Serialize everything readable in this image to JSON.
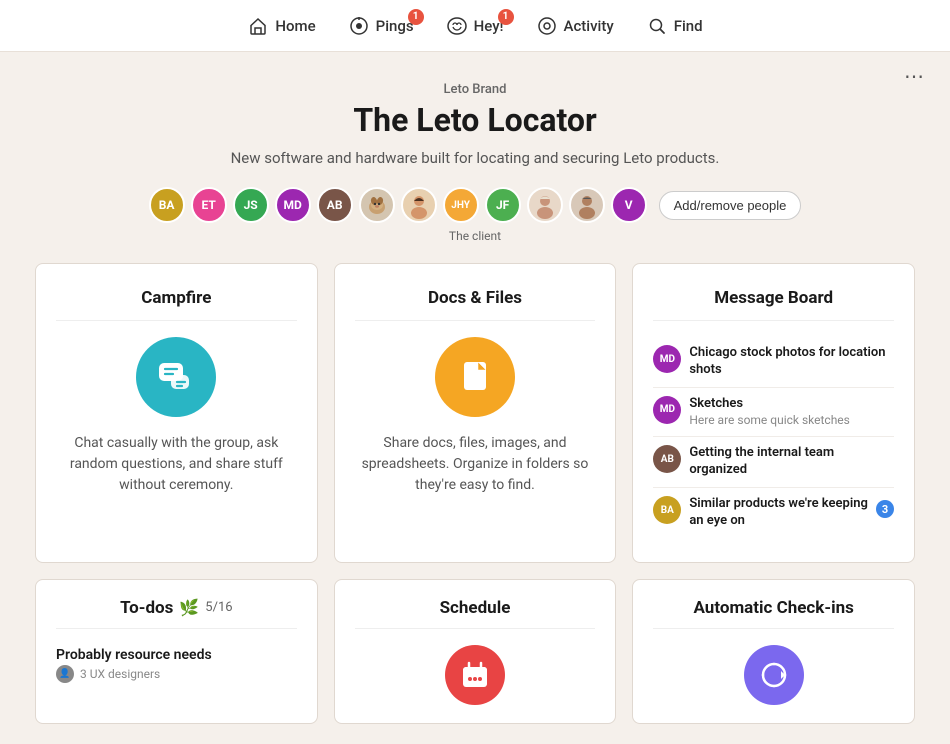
{
  "nav": {
    "items": [
      {
        "id": "home",
        "label": "Home",
        "icon": "🏠",
        "badge": null
      },
      {
        "id": "pings",
        "label": "Pings",
        "icon": "🔔",
        "badge": "1"
      },
      {
        "id": "hey",
        "label": "Hey!",
        "icon": "👋",
        "badge": "1"
      },
      {
        "id": "activity",
        "label": "Activity",
        "icon": "●",
        "badge": null
      },
      {
        "id": "find",
        "label": "Find",
        "icon": "🔍",
        "badge": null
      }
    ]
  },
  "project": {
    "brand": "Leto Brand",
    "title": "The Leto Locator",
    "description": "New software and hardware built for locating and securing Leto products."
  },
  "people": {
    "avatars": [
      {
        "initials": "BA",
        "color": "#c8a020",
        "type": "initials"
      },
      {
        "initials": "ET",
        "color": "#e84393",
        "type": "initials"
      },
      {
        "initials": "JS",
        "color": "#35a853",
        "type": "initials"
      },
      {
        "initials": "MD",
        "color": "#9c27b0",
        "type": "initials"
      },
      {
        "initials": "AB",
        "color": "#795548",
        "type": "initials"
      },
      {
        "initials": "🐶",
        "color": "#ddd",
        "type": "photo"
      },
      {
        "initials": "👩",
        "color": "#ddd",
        "type": "photo"
      },
      {
        "initials": "JHY",
        "color": "#f4a836",
        "type": "initials"
      },
      {
        "initials": "JF",
        "color": "#4caf50",
        "type": "initials"
      },
      {
        "initials": "👩‍🦳",
        "color": "#ddd",
        "type": "photo"
      },
      {
        "initials": "👨",
        "color": "#ddd",
        "type": "photo"
      },
      {
        "initials": "V",
        "color": "#9c27b0",
        "type": "initials"
      }
    ],
    "add_label": "Add/remove people",
    "group_label": "The client"
  },
  "cards": {
    "campfire": {
      "title": "Campfire",
      "desc": "Chat casually with the group, ask random questions, and share stuff without ceremony.",
      "icon_color": "#29b5c4",
      "icon": "💬"
    },
    "docs": {
      "title": "Docs & Files",
      "desc": "Share docs, files, images, and spreadsheets. Organize in folders so they're easy to find.",
      "icon_color": "#f5a623",
      "icon": "📄"
    },
    "message_board": {
      "title": "Message Board",
      "items": [
        {
          "initials": "MD",
          "color": "#9c27b0",
          "title": "Chicago stock photos for location shots",
          "sub": null,
          "badge": null
        },
        {
          "initials": "MD",
          "color": "#9c27b0",
          "title": "Sketches",
          "sub": "Here are some quick sketches",
          "badge": null
        },
        {
          "initials": "AB",
          "color": "#795548",
          "title": "Getting the internal team organized",
          "sub": null,
          "badge": null
        },
        {
          "initials": "BA",
          "color": "#c8a020",
          "title": "Similar products we're keeping an eye on",
          "sub": null,
          "badge": "3"
        }
      ]
    },
    "todos": {
      "title": "To-dos",
      "icon": "📋",
      "count": "5/16",
      "item_name": "Probably resource needs",
      "item_sub": "3 UX designers"
    },
    "schedule": {
      "title": "Schedule",
      "icon_color": "#e84444",
      "icon": "📅"
    },
    "checkins": {
      "title": "Automatic Check-ins",
      "icon_color": "#7b68ee",
      "icon": "🔄"
    }
  },
  "more_btn_label": "⋯"
}
